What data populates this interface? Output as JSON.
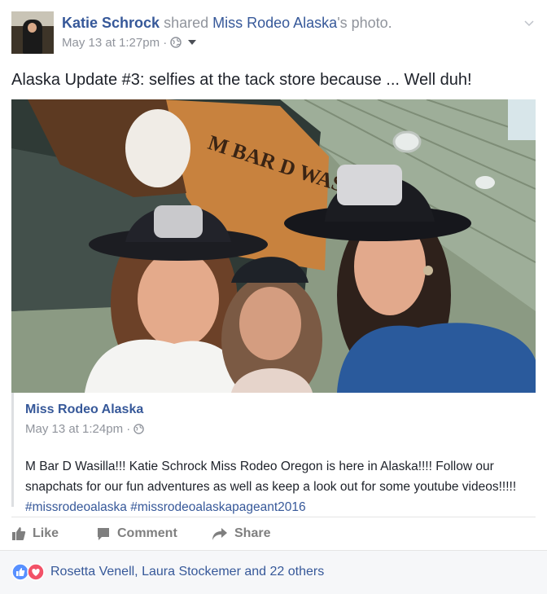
{
  "post": {
    "author": "Katie Schrock",
    "shared_word": " shared ",
    "shared_page": "Miss Rodeo Alaska",
    "shared_suffix": "'s photo.",
    "timestamp": "May 13 at 1:27pm",
    "separator": " · ",
    "status_text": "Alaska Update #3: selfies at the tack store because ... Well duh!",
    "photo_sign_text": "M BAR D WASILLA"
  },
  "shared": {
    "page_name": "Miss Rodeo Alaska",
    "timestamp": "May 13 at 1:24pm",
    "separator": " · ",
    "text": "M Bar D Wasilla!!! Katie Schrock Miss Rodeo Oregon is here in Alaska!!!! Follow our snapchats for our fun adventures as well as keep a look out for some youtube videos!!!!!",
    "hashtags": "#missrodeoalaska #missrodeoalaskapageant2016"
  },
  "actions": {
    "like": "Like",
    "comment": "Comment",
    "share": "Share"
  },
  "reactions": {
    "summary": "Rosetta Venell, Laura Stockemer and 22 others"
  },
  "colors": {
    "link": "#365899",
    "meta": "#90949c",
    "like_blue": "#5890ff",
    "love_red": "#f25268"
  }
}
